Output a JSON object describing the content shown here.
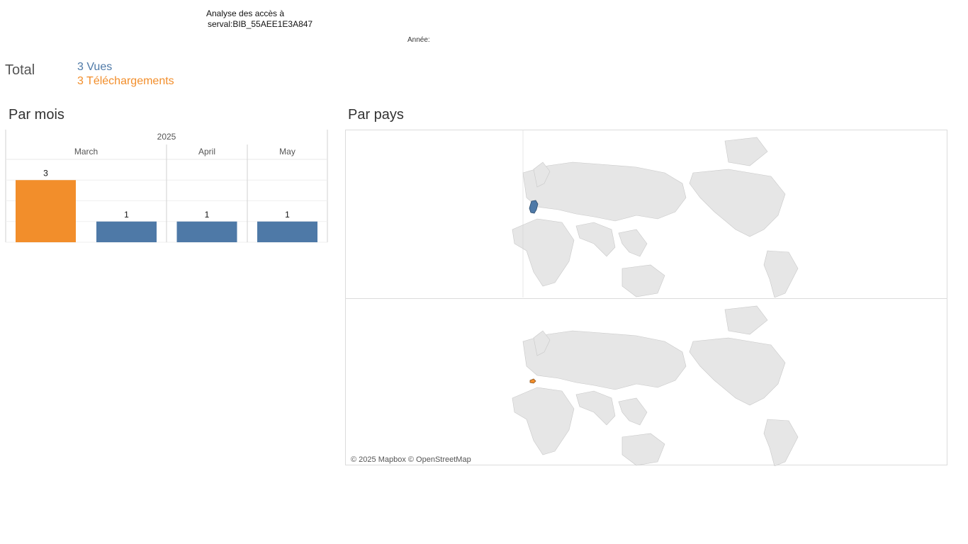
{
  "header": {
    "title_line1": "Analyse des accès à",
    "title_line2": "serval:BIB_55AEE1E3A847",
    "year_filter_label": "Année:"
  },
  "totals": {
    "label": "Total",
    "views": "3 Vues",
    "downloads": "3 Téléchargements"
  },
  "sections": {
    "by_month": "Par mois",
    "by_country": "Par pays"
  },
  "colors": {
    "views": "#4e79a7",
    "downloads": "#f28e2b",
    "land": "#e6e6e6",
    "borders": "#bdbdbd"
  },
  "chart_data": {
    "type": "bar",
    "year": "2025",
    "categories": [
      "March",
      "April",
      "May"
    ],
    "series": [
      {
        "key": "downloads",
        "values": [
          3,
          0,
          0
        ]
      },
      {
        "key": "views",
        "values": [
          1,
          1,
          1
        ]
      }
    ],
    "ylim": [
      0,
      3
    ],
    "grid": true
  },
  "map": {
    "attribution": "© 2025 Mapbox © OpenStreetMap",
    "views_countries": [
      "Germany"
    ],
    "downloads_countries": [
      "Switzerland"
    ]
  }
}
